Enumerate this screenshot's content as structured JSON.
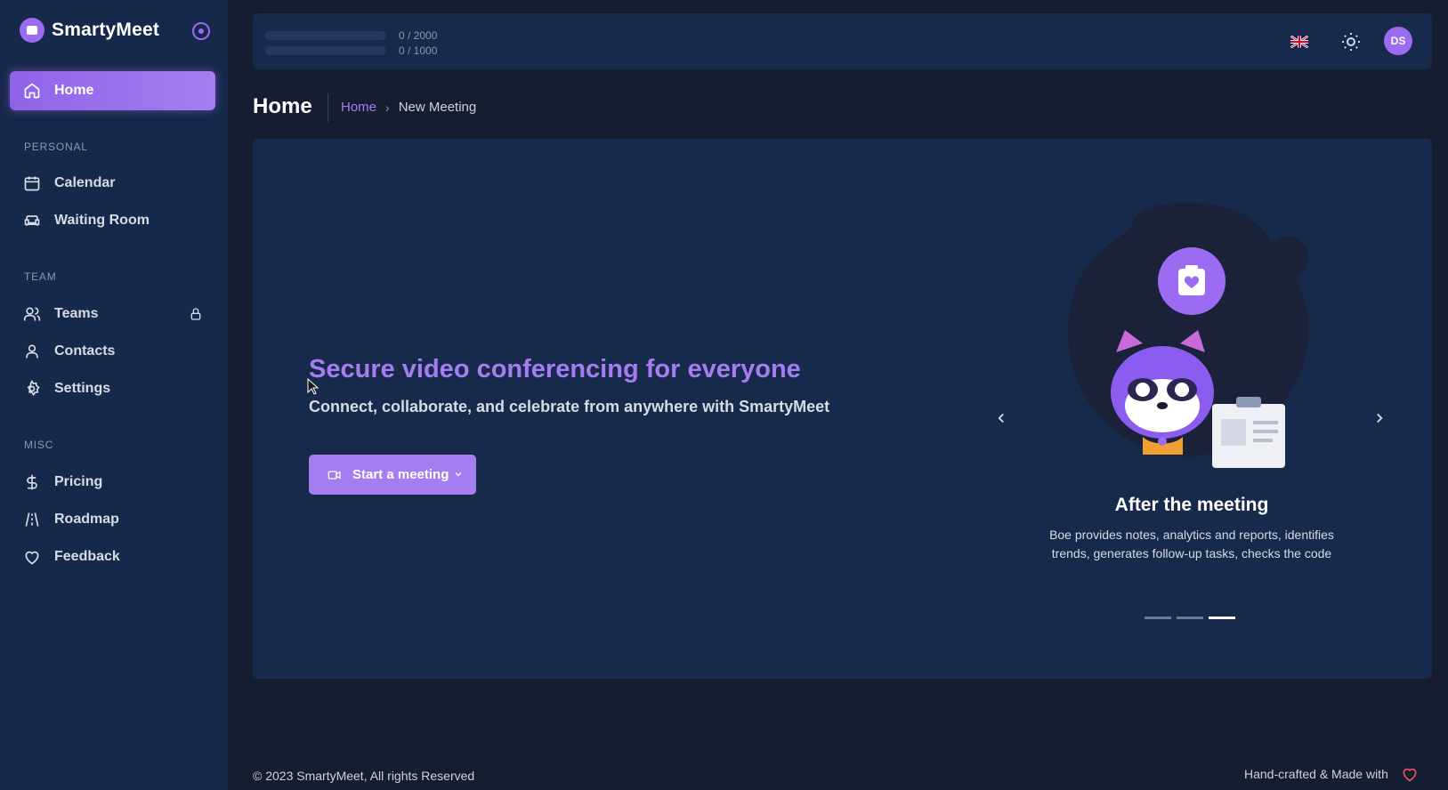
{
  "brand": {
    "name": "SmartyMeet"
  },
  "sidebar": {
    "home": "Home",
    "sections": {
      "personal": "PERSONAL",
      "team": "TEAM",
      "misc": "MISC"
    },
    "items": {
      "calendar": "Calendar",
      "waiting_room": "Waiting Room",
      "teams": "Teams",
      "contacts": "Contacts",
      "settings": "Settings",
      "pricing": "Pricing",
      "roadmap": "Roadmap",
      "feedback": "Feedback"
    }
  },
  "topbar": {
    "quota1_text": "0 / 2000",
    "quota1_fraction": 0,
    "quota2_text": "0 / 1000",
    "quota2_fraction": 0,
    "avatar_initials": "DS"
  },
  "page": {
    "title": "Home",
    "breadcrumb_home": "Home",
    "breadcrumb_current": "New Meeting"
  },
  "hero": {
    "title": "Secure video conferencing for everyone",
    "subtitle": "Connect, collaborate, and celebrate from anywhere with SmartyMeet",
    "button_label": "Start a meeting"
  },
  "carousel": {
    "title": "After the meeting",
    "description": "Boe provides notes, analytics and reports, identifies trends, generates follow-up tasks, checks the code",
    "active_index": 2,
    "count": 3
  },
  "footer": {
    "copyright": "© 2023 SmartyMeet, All rights Reserved",
    "made_with": "Hand-crafted & Made with"
  },
  "colors": {
    "accent": "#a47ef0",
    "background": "#161d31",
    "card": "#172a4b"
  }
}
